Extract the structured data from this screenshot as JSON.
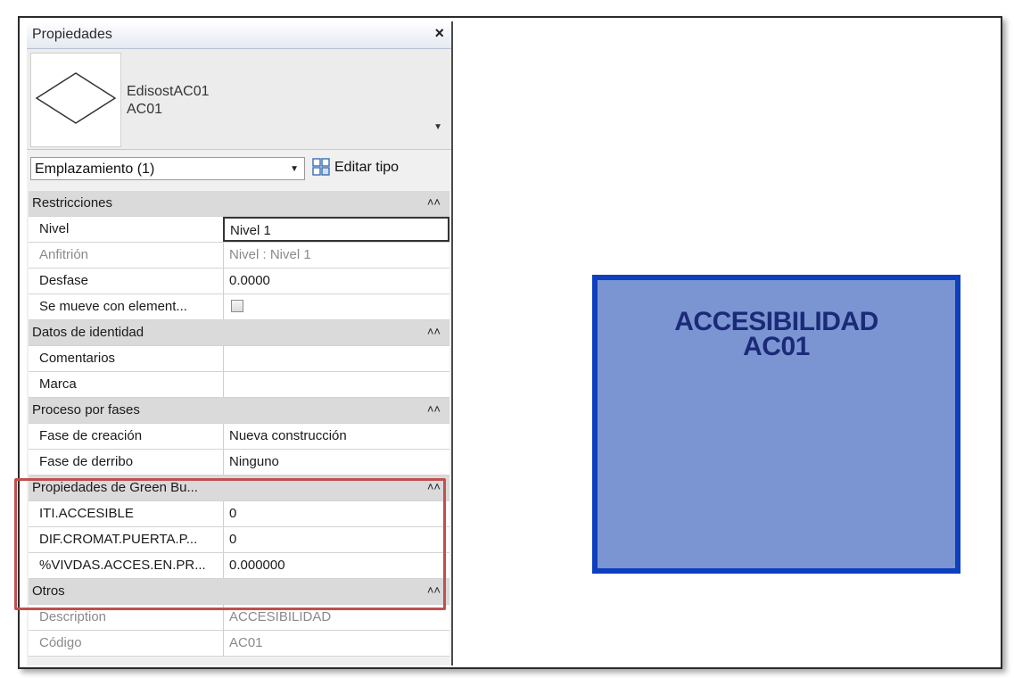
{
  "panel": {
    "title": "Propiedades",
    "close": "×",
    "type": {
      "family": "EdisostAC01",
      "name": "AC01"
    },
    "selector": {
      "value": "Emplazamiento (1)"
    },
    "edit_type_label": "Editar tipo"
  },
  "groups": [
    {
      "label": "Restricciones"
    },
    {
      "label": "Datos de identidad"
    },
    {
      "label": "Proceso por fases"
    },
    {
      "label": "Propiedades de Green Bu..."
    },
    {
      "label": "Otros"
    }
  ],
  "props": [
    {
      "label": "Nivel",
      "value": "Nivel 1"
    },
    {
      "label": "Anfitrión",
      "value": "Nivel : Nivel 1"
    },
    {
      "label": "Desfase",
      "value": "0.0000"
    },
    {
      "label": "Se mueve con element...",
      "checked": false
    },
    {
      "label": "Comentarios",
      "value": ""
    },
    {
      "label": "Marca",
      "value": ""
    },
    {
      "label": "Fase de creación",
      "value": "Nueva construcción"
    },
    {
      "label": "Fase de derribo",
      "value": "Ninguno"
    },
    {
      "label": "ITI.ACCESIBLE",
      "value": "0"
    },
    {
      "label": "DIF.CROMAT.PUERTA.P...",
      "value": "0"
    },
    {
      "label": "%VIVDAS.ACCES.EN.PR...",
      "value": "0.000000"
    },
    {
      "label": "Description",
      "value": "ACCESIBILIDAD"
    },
    {
      "label": "Código",
      "value": "AC01"
    }
  ],
  "canvas": {
    "tag_line1": "ACCESIBILIDAD",
    "tag_line2": "AC01",
    "fill_color": "#7b95d2",
    "border_color": "#0e3fbe"
  },
  "highlight_color": "#c0504d"
}
